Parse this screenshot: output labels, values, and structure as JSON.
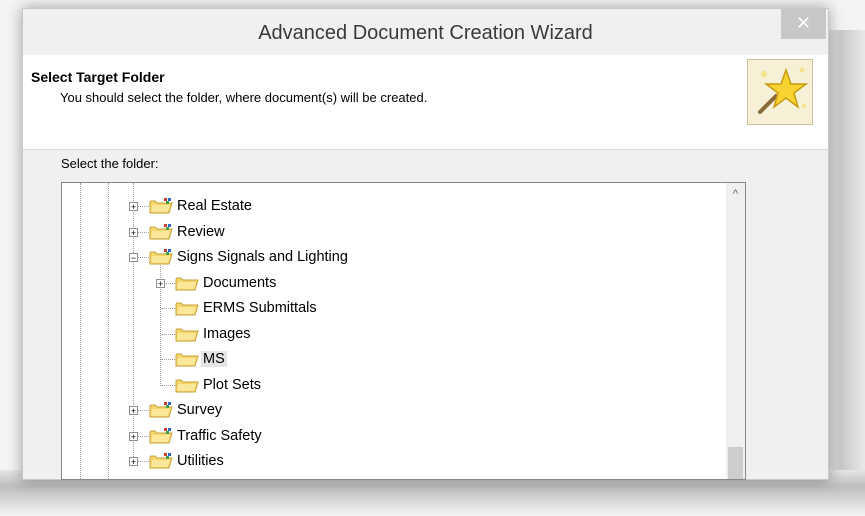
{
  "window": {
    "title": "Advanced Document Creation Wizard",
    "close_glyph": "✕"
  },
  "header": {
    "title": "Select Target Folder",
    "description": "You should select the folder, where document(s) will be created.",
    "icon": "wizard-star-icon"
  },
  "folder_label": "Select the folder:",
  "tree": {
    "items": [
      {
        "label": "Real Estate",
        "expander": "+",
        "icon": "project-folder-icon"
      },
      {
        "label": "Review",
        "expander": "+",
        "icon": "project-folder-icon"
      },
      {
        "label": "Signs Signals and Lighting",
        "expander": "−",
        "icon": "project-folder-icon"
      },
      {
        "label": "Documents",
        "expander": "+",
        "icon": "folder-icon"
      },
      {
        "label": "ERMS Submittals",
        "expander": "",
        "icon": "folder-icon"
      },
      {
        "label": "Images",
        "expander": "",
        "icon": "folder-icon"
      },
      {
        "label": "MS",
        "expander": "",
        "icon": "folder-icon",
        "selected": true
      },
      {
        "label": "Plot Sets",
        "expander": "",
        "icon": "folder-icon"
      },
      {
        "label": "Survey",
        "expander": "+",
        "icon": "project-folder-icon"
      },
      {
        "label": "Traffic Safety",
        "expander": "+",
        "icon": "project-folder-icon"
      },
      {
        "label": "Utilities",
        "expander": "+",
        "icon": "project-folder-icon"
      }
    ]
  },
  "scrollbar": {
    "up_glyph": "^"
  },
  "colors": {
    "accent": "#e5e5e5",
    "folder": "#f5d66b",
    "project_mark_red": "#d23b2a",
    "project_mark_green": "#3aa34a",
    "project_mark_blue": "#2c66c9"
  }
}
